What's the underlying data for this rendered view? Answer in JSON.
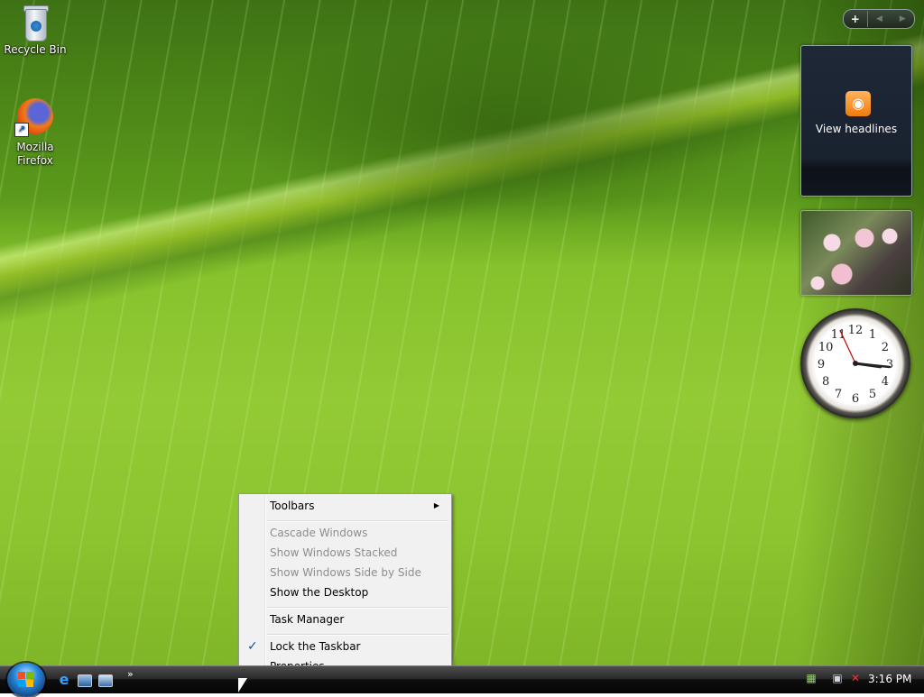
{
  "desktop_icons": [
    {
      "label": "Recycle Bin",
      "icon": "recycle-bin-icon"
    },
    {
      "label": "Mozilla Firefox",
      "icon": "firefox-icon"
    }
  ],
  "sidebar": {
    "add_symbol": "+",
    "prev_symbol": "◀",
    "next_symbol": "▶"
  },
  "gadgets": {
    "feed_headlines": {
      "label": "View headlines",
      "icon": "rss-icon"
    },
    "slideshow": {
      "icon": "flower-photo"
    },
    "clock": {
      "numerals": [
        "12",
        "1",
        "2",
        "3",
        "4",
        "5",
        "6",
        "7",
        "8",
        "9",
        "10",
        "11"
      ],
      "time_shown": "3:16"
    }
  },
  "context_menu": {
    "items": [
      {
        "label": "Toolbars",
        "enabled": true,
        "submenu": true
      },
      {
        "label": "Cascade Windows",
        "enabled": false
      },
      {
        "label": "Show Windows Stacked",
        "enabled": false
      },
      {
        "label": "Show Windows Side by Side",
        "enabled": false
      },
      {
        "label": "Show the Desktop",
        "enabled": true
      },
      {
        "label": "Task Manager",
        "enabled": true
      },
      {
        "label": "Lock the Taskbar",
        "enabled": true,
        "checked": true
      },
      {
        "label": "Properties",
        "enabled": true
      }
    ],
    "check_symbol": "✓",
    "submenu_symbol": "▶"
  },
  "taskbar": {
    "start_button": "start-orb-icon",
    "quick_launch": [
      "internet-explorer-icon",
      "show-desktop-icon",
      "switch-windows-icon"
    ],
    "quick_launch_more": "»",
    "tray_icons": [
      "language-icon",
      "network-icon",
      "volume-muted-icon"
    ],
    "time": "3:16 PM"
  },
  "colors": {
    "wallpaper_green": "#8cc52f",
    "menu_bg": "#f1f1f1",
    "disabled_text": "#8d8d8d",
    "taskbar_bg": "#0e0e0e"
  }
}
